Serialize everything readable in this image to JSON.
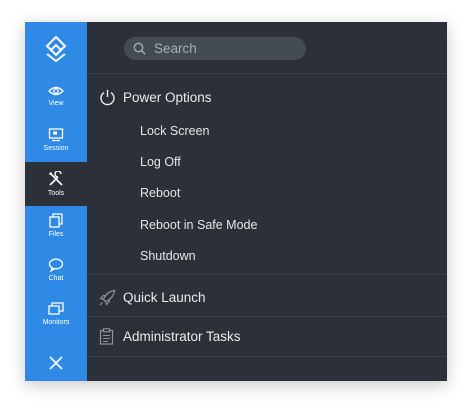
{
  "sidebar": {
    "logo_icon": "nested-diamonds-logo",
    "items": [
      {
        "label": "View",
        "icon": "eye-icon"
      },
      {
        "label": "Session",
        "icon": "monitor-session-icon"
      },
      {
        "label": "Tools",
        "icon": "tools-icon",
        "active": true
      },
      {
        "label": "Files",
        "icon": "files-icon"
      },
      {
        "label": "Chat",
        "icon": "chat-bubble-icon"
      },
      {
        "label": "Monitors",
        "icon": "monitors-icon"
      }
    ],
    "close_icon": "close-icon"
  },
  "search": {
    "placeholder": "Search",
    "value": ""
  },
  "menu": {
    "power_options": {
      "label": "Power Options",
      "icon": "power-icon",
      "items": [
        "Lock Screen",
        "Log Off",
        "Reboot",
        "Reboot in Safe Mode",
        "Shutdown"
      ]
    },
    "quick_launch": {
      "label": "Quick Launch",
      "icon": "rocket-icon"
    },
    "administrator_tasks": {
      "label": "Administrator Tasks",
      "icon": "clipboard-icon"
    }
  },
  "colors": {
    "sidebar": "#2f8ae6",
    "panel": "#2b3039",
    "search_bg": "#454b55",
    "text": "#e8ebf0"
  }
}
